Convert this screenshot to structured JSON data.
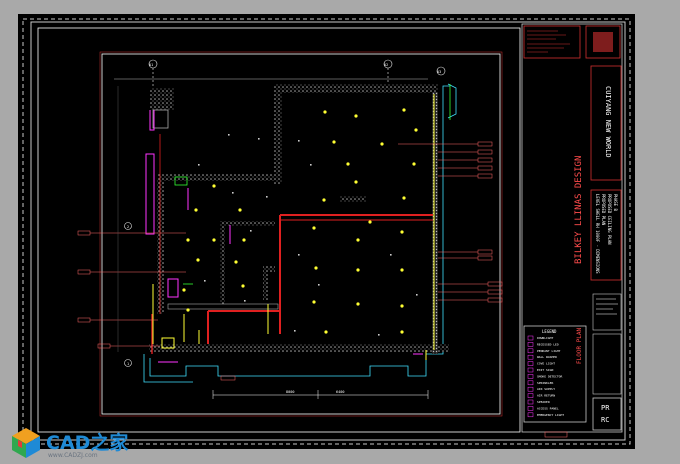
{
  "drawing": {
    "title_block": {
      "firm_name": "BILKEY LLINAS DESIGN",
      "project_name": "CUIYANG NEW WORLD",
      "sheet_title": "LEVEL SHELL RH 1000F - DIMENSIONS",
      "sheet_subtitle_1": "PROPOSED PLAN",
      "sheet_subtitle_2": "PROPOSED CEILING PLAN",
      "phase": "PHASE B",
      "sheet_number_1": "PR",
      "sheet_number_2": "RC",
      "vertical_label": "FLOOR PLAN",
      "legend_heading": "LEGEND",
      "legend_items": [
        "DOWNLIGHT",
        "RECESSED LED",
        "PENDANT LIGHT",
        "WALL WASHER",
        "COVE LIGHT",
        "EXIT SIGN",
        "SMOKE DETECTOR",
        "SPRINKLER",
        "AIR SUPPLY",
        "AIR RETURN",
        "SPEAKER",
        "ACCESS PANEL",
        "EMERGENCY LIGHT"
      ]
    },
    "dimensions": [
      "8000",
      "6400"
    ],
    "grid_labels": [
      "A1",
      "A2",
      "A3",
      "1",
      "2"
    ],
    "colors": {
      "background": "#000000",
      "frame": "#c8c8c8",
      "border_red": "#d23030",
      "wall_hatch": "#9a9a9a",
      "wall_red": "#e02020",
      "yellow": "#ffff33",
      "cyan": "#3fe0ff",
      "magenta": "#ff33ff",
      "green": "#33ff33"
    }
  },
  "watermark": {
    "brand": "CAD之家",
    "url": "www.CADZJ.com",
    "logo_icon": "cube-logo-icon"
  }
}
